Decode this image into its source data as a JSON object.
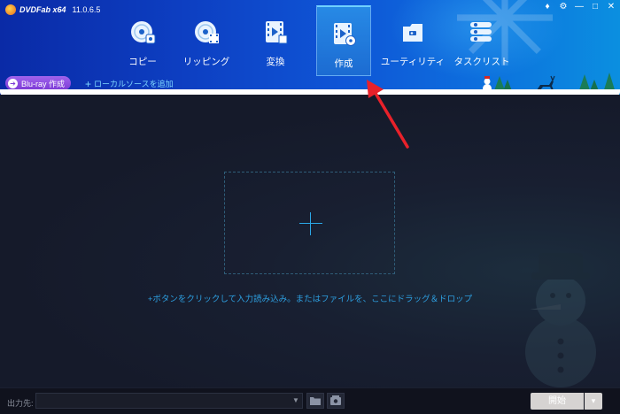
{
  "app": {
    "name": "DVDFab x64",
    "version": "11.0.6.5"
  },
  "window_controls": {
    "icons": [
      "pin-icon",
      "settings-icon",
      "minimize-icon",
      "maximize-icon",
      "close-icon"
    ],
    "glyphs": [
      "♦",
      "⚙",
      "—",
      "□",
      "✕"
    ]
  },
  "tabs": [
    {
      "label": "コピー",
      "icon": "disc-copy-icon",
      "active": false
    },
    {
      "label": "リッピング",
      "icon": "disc-rip-icon",
      "active": false
    },
    {
      "label": "変換",
      "icon": "film-convert-icon",
      "active": false
    },
    {
      "label": "作成",
      "icon": "film-create-icon",
      "active": true
    },
    {
      "label": "ユーティリティ",
      "icon": "toolbox-icon",
      "active": false
    },
    {
      "label": "タスクリスト",
      "icon": "task-list-icon",
      "active": false
    }
  ],
  "toolbar": {
    "bd_create_label": "Blu-ray 作成",
    "add_source_label": "ローカルソースを追加"
  },
  "main": {
    "hint": "+ボタンをクリックして入力読み込み。またはファイルを、ここにドラッグ＆ドロップ"
  },
  "bottom": {
    "output_label": "出力先:",
    "output_value": "",
    "start_label": "開始"
  },
  "colors": {
    "accent": "#2ba8e8",
    "active_tab_border": "#6fd0ff",
    "bd_button": "#8a4ae0",
    "annotation_arrow": "#e8212a"
  }
}
